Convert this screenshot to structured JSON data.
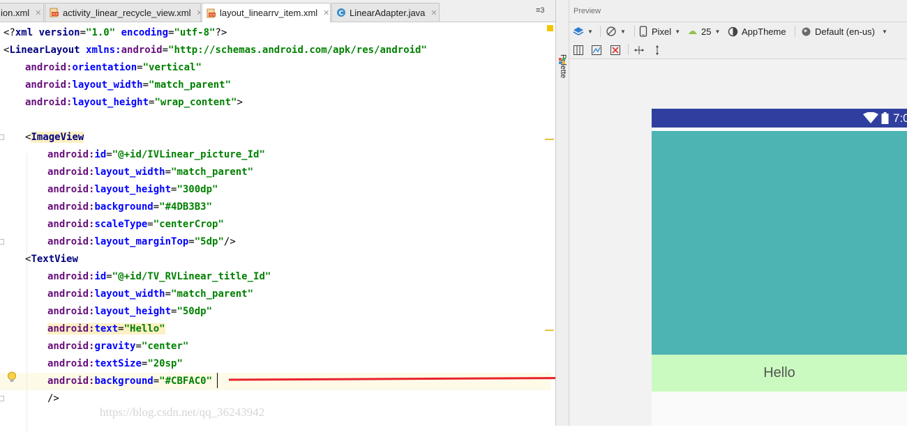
{
  "tabs": [
    {
      "label": "ion.xml",
      "icon": "xml-file-icon",
      "active": false
    },
    {
      "label": "activity_linear_recycle_view.xml",
      "icon": "xml-file-icon",
      "active": false
    },
    {
      "label": "layout_linearrv_item.xml",
      "icon": "xml-file-icon",
      "active": true
    },
    {
      "label": "LinearAdapter.java",
      "icon": "java-class-icon",
      "active": false
    }
  ],
  "tab_overflow": "≡3",
  "code": {
    "l1": {
      "p1": "<?",
      "p2": "xml version",
      "p3": "=",
      "p4": "\"1.0\"",
      "p5": " encoding",
      "p6": "=",
      "p7": "\"utf-8\"",
      "p8": "?>"
    },
    "l2": {
      "p1": "<",
      "p2": "LinearLayout ",
      "p3": "xmlns:",
      "p4": "android",
      "p5": "=",
      "p6": "\"http://schemas.android.com/apk/res/android\""
    },
    "l3": {
      "ns": "android:",
      "attr": "orientation",
      "eq": "=",
      "val": "\"vertical\""
    },
    "l4": {
      "ns": "android:",
      "attr": "layout_width",
      "eq": "=",
      "val": "\"match_parent\""
    },
    "l5": {
      "ns": "android:",
      "attr": "layout_height",
      "eq": "=",
      "val": "\"wrap_content\"",
      "end": ">"
    },
    "l7": {
      "open": "<",
      "tag": "ImageView"
    },
    "l8": {
      "ns": "android:",
      "attr": "id",
      "eq": "=",
      "val": "\"@+id/IVLinear_picture_Id\""
    },
    "l9": {
      "ns": "android:",
      "attr": "layout_width",
      "eq": "=",
      "val": "\"match_parent\""
    },
    "l10": {
      "ns": "android:",
      "attr": "layout_height",
      "eq": "=",
      "val": "\"300dp\""
    },
    "l11": {
      "ns": "android:",
      "attr": "background",
      "eq": "=",
      "val": "\"#4DB3B3\""
    },
    "l12": {
      "ns": "android:",
      "attr": "scaleType",
      "eq": "=",
      "val": "\"centerCrop\""
    },
    "l13": {
      "ns": "android:",
      "attr": "layout_marginTop",
      "eq": "=",
      "val": "\"5dp\"",
      "end": "/>"
    },
    "l14": {
      "open": "<",
      "tag": "TextView"
    },
    "l15": {
      "ns": "android:",
      "attr": "id",
      "eq": "=",
      "val": "\"@+id/TV_RVLinear_title_Id\""
    },
    "l16": {
      "ns": "android:",
      "attr": "layout_width",
      "eq": "=",
      "val": "\"match_parent\""
    },
    "l17": {
      "ns": "android:",
      "attr": "layout_height",
      "eq": "=",
      "val": "\"50dp\""
    },
    "l18": {
      "ns": "android:",
      "attr": "text",
      "eq": "=",
      "val": "\"Hello\""
    },
    "l19": {
      "ns": "android:",
      "attr": "gravity",
      "eq": "=",
      "val": "\"center\""
    },
    "l20": {
      "ns": "android:",
      "attr": "textSize",
      "eq": "=",
      "val": "\"20sp\""
    },
    "l21": {
      "ns": "android:",
      "attr": "background",
      "eq": "=",
      "val": "\"#CBFAC0",
      "val2": "\""
    },
    "l22": {
      "end": "/>"
    }
  },
  "preview": {
    "title": "Preview",
    "palette_label": "Palette",
    "device": "Pixel",
    "api_level": "25",
    "theme": "AppTheme",
    "locale": "Default (en-us)",
    "status_time": "7:0",
    "text_view_text": "Hello"
  },
  "colors": {
    "image_view_bg": "#4DB3B3",
    "text_view_bg": "#CBFAC0",
    "status_bar": "#303F9F",
    "arrow": "#E8232A"
  },
  "watermark": "https://blog.csdn.net/qq_36243942"
}
